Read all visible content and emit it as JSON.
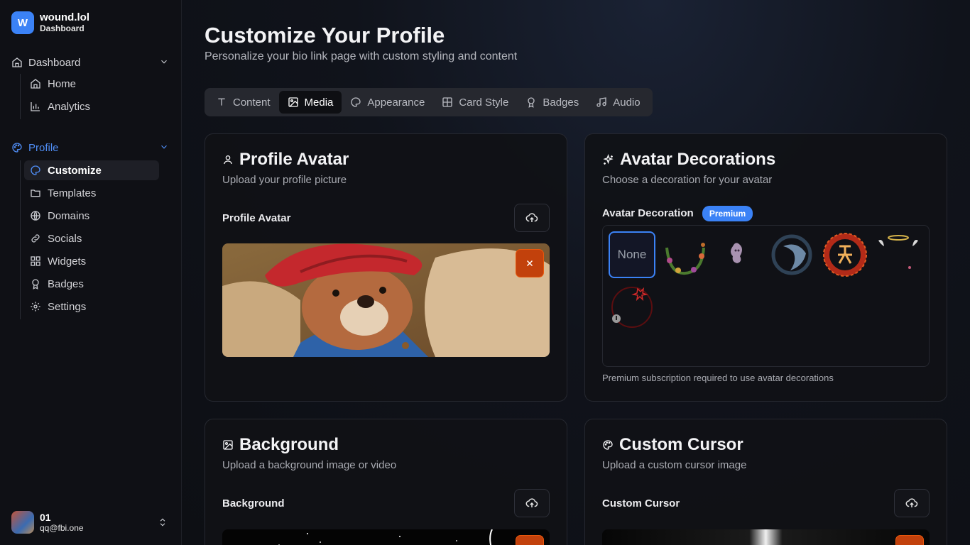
{
  "brand": {
    "letter": "W",
    "name": "wound.lol",
    "section": "Dashboard"
  },
  "nav": {
    "dashboard": {
      "label": "Dashboard",
      "items": [
        {
          "label": "Home"
        },
        {
          "label": "Analytics"
        }
      ]
    },
    "profile": {
      "label": "Profile",
      "items": [
        {
          "label": "Customize"
        },
        {
          "label": "Templates"
        },
        {
          "label": "Domains"
        },
        {
          "label": "Socials"
        },
        {
          "label": "Widgets"
        },
        {
          "label": "Badges"
        },
        {
          "label": "Settings"
        }
      ]
    }
  },
  "user": {
    "name": "01",
    "email": "qq@fbi.one"
  },
  "page": {
    "title": "Customize Your Profile",
    "subtitle": "Personalize your bio link page with custom styling and content"
  },
  "tabs": [
    {
      "label": "Content",
      "icon": "text-icon"
    },
    {
      "label": "Media",
      "icon": "image-icon",
      "active": true
    },
    {
      "label": "Appearance",
      "icon": "palette-icon"
    },
    {
      "label": "Card Style",
      "icon": "grid-icon"
    },
    {
      "label": "Badges",
      "icon": "award-icon"
    },
    {
      "label": "Audio",
      "icon": "music-icon"
    }
  ],
  "cards": {
    "avatar": {
      "title": "Profile Avatar",
      "subtitle": "Upload your profile picture",
      "field_label": "Profile Avatar"
    },
    "decorations": {
      "title": "Avatar Decorations",
      "subtitle": "Choose a decoration for your avatar",
      "field_label": "Avatar Decoration",
      "badge": "Premium",
      "none_label": "None",
      "note": "Premium subscription required to use avatar decorations"
    },
    "background": {
      "title": "Background",
      "subtitle": "Upload a background image or video",
      "field_label": "Background"
    },
    "cursor": {
      "title": "Custom Cursor",
      "subtitle": "Upload a custom cursor image",
      "field_label": "Custom Cursor"
    }
  },
  "colors": {
    "accent": "#3b82f6",
    "danger": "#c2410c"
  }
}
